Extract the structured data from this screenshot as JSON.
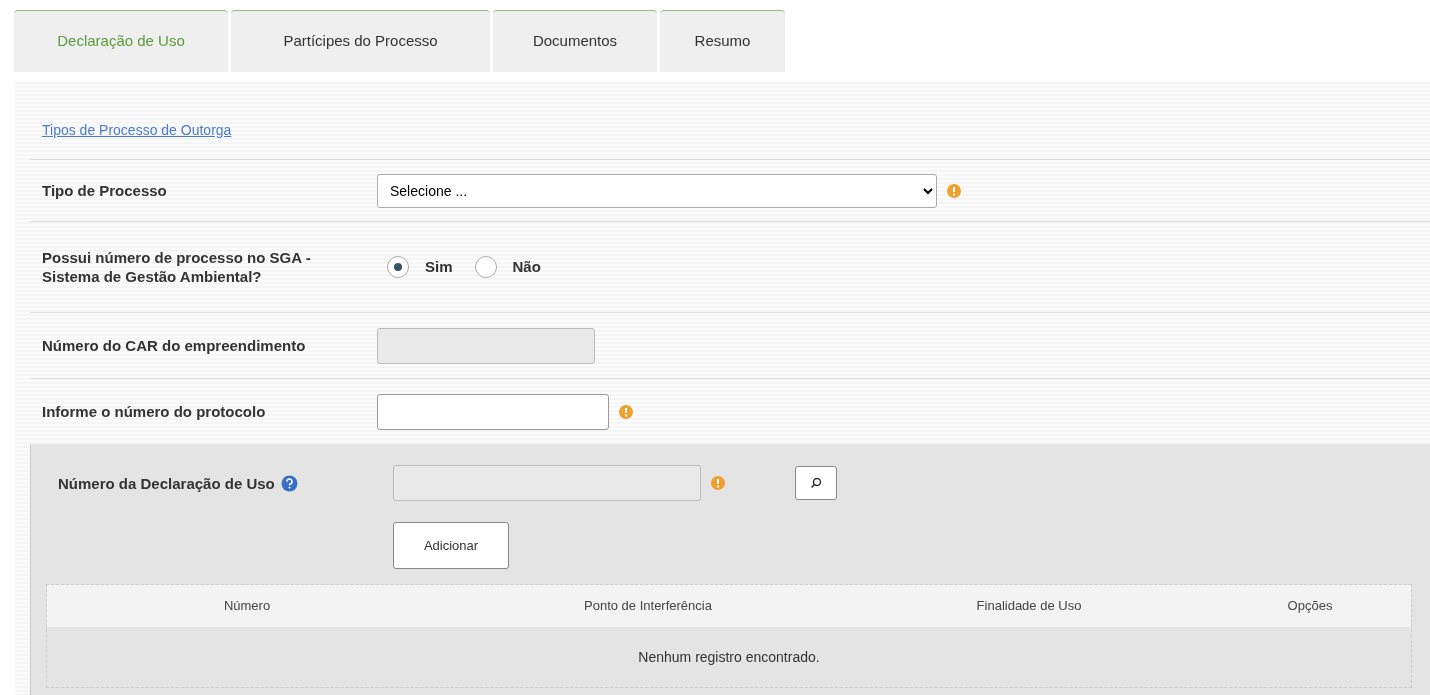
{
  "tabs": [
    {
      "label": "Declaração de Uso",
      "selected": true
    },
    {
      "label": "Partícipes do Processo",
      "selected": false
    },
    {
      "label": "Documentos",
      "selected": false
    },
    {
      "label": "Resumo",
      "selected": false
    }
  ],
  "link": "Tipos de Processo de Outorga",
  "fields": [
    {
      "kind": "select",
      "label": "Tipo de Processo",
      "value": "Selecione ...",
      "required": true
    },
    {
      "kind": "radio",
      "label": "Possui número de processo no SGA - Sistema de Gestão Ambiental?",
      "options": [
        {
          "label": "Sim",
          "selected": true
        },
        {
          "label": "Não",
          "selected": false
        }
      ]
    },
    {
      "kind": "text",
      "label": "Número do CAR do empreendimento",
      "disabled": true
    },
    {
      "kind": "text",
      "label": "Informe o número do protocolo",
      "disabled": false,
      "required": true
    }
  ],
  "declaracao": {
    "label": "Número da Declaração de Uso",
    "disabled": true,
    "required": true,
    "add_button": "Adicionar"
  },
  "table": {
    "columns": [
      "Número",
      "Ponto de Interferência",
      "Finalidade de Uso",
      "Opções"
    ],
    "empty_message": "Nenhum registro encontrado."
  }
}
